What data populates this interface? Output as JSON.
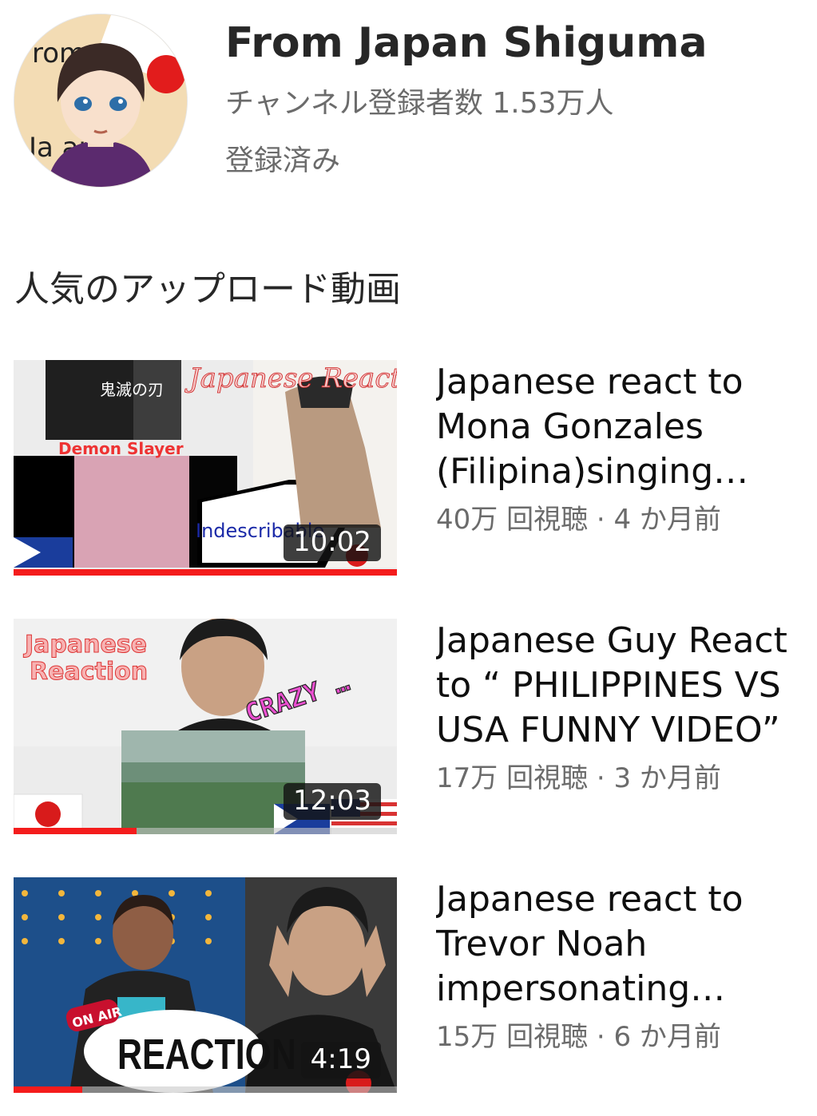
{
  "channel": {
    "name": "From Japan Shiguma",
    "subscribers": "チャンネル登録者数 1.53万人",
    "subscribed_label": "登録済み",
    "avatar_text": "From Japan"
  },
  "section": {
    "title": "人気のアップロード動画"
  },
  "colors": {
    "accent_red": "#f41c1c",
    "secondary_text": "#6b6b6b"
  },
  "videos": [
    {
      "title": "Japanese react to Mona Gonzales (Filipina)singing Japanese",
      "stats": "40万 回視聴 · 4 か月前",
      "duration": "10:02",
      "progress": 1.0,
      "thumb_texts": {
        "brand": "Japanese Reaction",
        "series": "鬼滅の刃",
        "caption": "Demon Slayer",
        "bubble": "Indescribable"
      }
    },
    {
      "title": "Japanese Guy React to “ PHILIPPINES VS USA FUNNY VIDEO”",
      "stats": "17万 回視聴 · 3 か月前",
      "duration": "12:03",
      "progress": 0.32,
      "thumb_texts": {
        "brand_line1": "Japanese",
        "brand_line2": "Reaction",
        "sticker": "CRAZY …"
      }
    },
    {
      "title": "Japanese react to Trevor  Noah impersonating Japanese",
      "stats": "15万 回視聴 · 6 か月前",
      "duration": "4:19",
      "progress": 0.18,
      "thumb_texts": {
        "on_air": "ON AIR",
        "label": "REACTION"
      }
    }
  ]
}
